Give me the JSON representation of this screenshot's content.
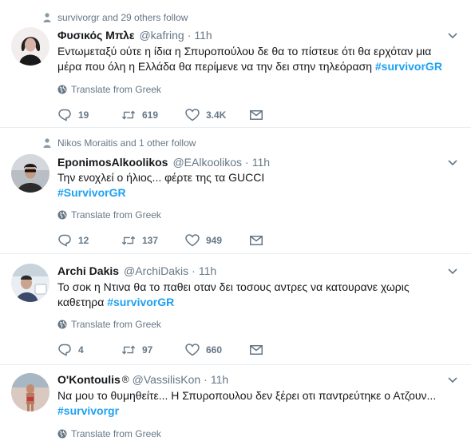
{
  "colors": {
    "hashtag": "#1da1f2",
    "muted": "#657786",
    "divider": "#e6ecf0"
  },
  "icons": {
    "social": "person-icon",
    "caret": "chevron-down-icon",
    "translate": "globe-icon",
    "reply": "reply-icon",
    "retweet": "retweet-icon",
    "like": "heart-icon",
    "dm": "envelope-icon"
  },
  "tweets": [
    {
      "social_context": "survivorgr and 29 others follow",
      "name": "Φυσικός Μπλε",
      "verified_mark": "",
      "handle": "@kafring",
      "time": "11h",
      "text_lines": [
        {
          "text": "Εντωμεταξύ ούτε η ίδια η Σπυροπούλου δε θα το πίστευε ότι θα ερχόταν μια",
          "hashtag": ""
        },
        {
          "text": "μέρα που όλη η Ελλάδα θα περίμενε να την δει στην τηλεόραση ",
          "hashtag": "#survivorGR"
        }
      ],
      "translate": "Translate from Greek",
      "replies": "19",
      "retweets": "619",
      "likes": "3.4K"
    },
    {
      "social_context": "Nikos Moraitis and 1 other follow",
      "name": "ΕponimosAlkoolikos",
      "verified_mark": "",
      "handle": "@EAlkoolikos",
      "time": "11h",
      "text_lines": [
        {
          "text": "Την ενοχλεί ο ήλιος... φέρτε της τα  GUCCI",
          "hashtag": ""
        },
        {
          "text": "",
          "hashtag": "#SurvivorGR"
        }
      ],
      "translate": "Translate from Greek",
      "replies": "12",
      "retweets": "137",
      "likes": "949"
    },
    {
      "social_context": "",
      "name": "Archi Dakis",
      "verified_mark": "",
      "handle": "@ArchiDakis",
      "time": "11h",
      "text_lines": [
        {
          "text": "Το σοκ η Ντινα θα το παθει οταν δει τοσους αντρες να κατουρανε χωρις",
          "hashtag": ""
        },
        {
          "text": "καθετηρα ",
          "hashtag": "#survivorGR"
        }
      ],
      "translate": "Translate from Greek",
      "replies": "4",
      "retweets": "97",
      "likes": "660"
    },
    {
      "social_context": "",
      "name": "O'Kontoulis",
      "verified_mark": "®",
      "handle": "@VassilisKon",
      "time": "11h",
      "text_lines": [
        {
          "text": "Να μου το θυμηθείτε... Η Σπυροπουλου δεν ξέρει οτι παντρεύτηκε ο Ατζουν...",
          "hashtag": ""
        },
        {
          "text": "",
          "hashtag": "#survivorgr"
        }
      ],
      "translate": "Translate from Greek",
      "replies": "",
      "retweets": "",
      "likes": ""
    }
  ]
}
